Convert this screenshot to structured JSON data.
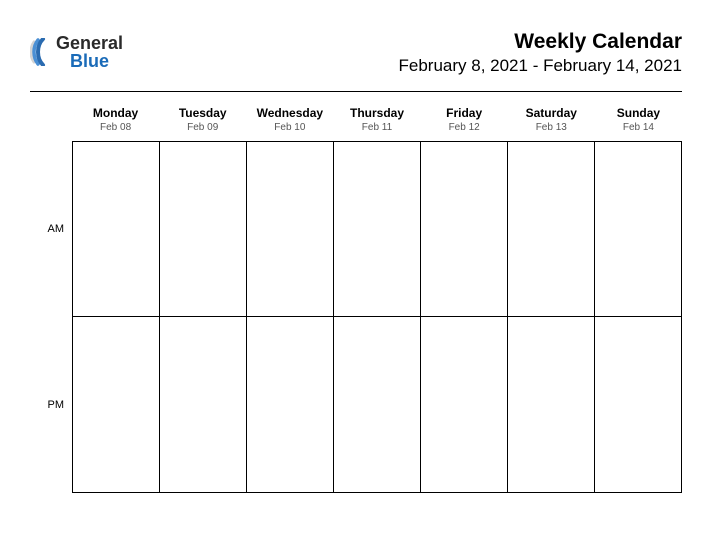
{
  "logo": {
    "line1": "General",
    "line2": "Blue"
  },
  "header": {
    "title": "Weekly Calendar",
    "subtitle": "February 8, 2021 - February 14, 2021"
  },
  "days": [
    {
      "name": "Monday",
      "date": "Feb 08"
    },
    {
      "name": "Tuesday",
      "date": "Feb 09"
    },
    {
      "name": "Wednesday",
      "date": "Feb 10"
    },
    {
      "name": "Thursday",
      "date": "Feb 11"
    },
    {
      "name": "Friday",
      "date": "Feb 12"
    },
    {
      "name": "Saturday",
      "date": "Feb 13"
    },
    {
      "name": "Sunday",
      "date": "Feb 14"
    }
  ],
  "periods": [
    {
      "label": "AM"
    },
    {
      "label": "PM"
    }
  ]
}
